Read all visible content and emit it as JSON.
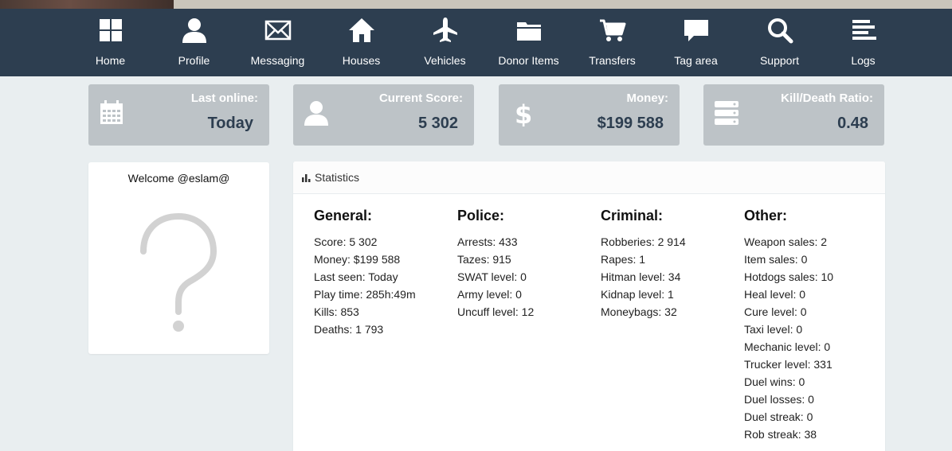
{
  "nav": [
    {
      "label": "Home",
      "icon": "grid-icon"
    },
    {
      "label": "Profile",
      "icon": "user-icon"
    },
    {
      "label": "Messaging",
      "icon": "envelope-icon"
    },
    {
      "label": "Houses",
      "icon": "house-icon"
    },
    {
      "label": "Vehicles",
      "icon": "plane-icon"
    },
    {
      "label": "Donor Items",
      "icon": "folder-icon"
    },
    {
      "label": "Transfers",
      "icon": "cart-icon"
    },
    {
      "label": "Tag area",
      "icon": "chat-bubble-icon"
    },
    {
      "label": "Support",
      "icon": "search-icon"
    },
    {
      "label": "Logs",
      "icon": "list-icon"
    }
  ],
  "stats": [
    {
      "label": "Last online:",
      "value": "Today",
      "icon": "calendar-icon"
    },
    {
      "label": "Current Score:",
      "value": "5 302",
      "icon": "user-icon"
    },
    {
      "label": "Money:",
      "value": "$199 588",
      "icon": "dollar-icon"
    },
    {
      "label": "Kill/Death Ratio:",
      "value": "0.48",
      "icon": "server-icon"
    }
  ],
  "welcome": {
    "text": "Welcome @eslam@",
    "avatar_icon": "question-mark-icon"
  },
  "panel": {
    "title": "Statistics",
    "icon": "bar-chart-icon",
    "columns": [
      {
        "heading": "General:",
        "rows": [
          "Score: 5 302",
          "Money: $199 588",
          "Last seen: Today",
          "Play time: 285h:49m",
          "Kills: 853",
          "Deaths: 1 793"
        ]
      },
      {
        "heading": "Police:",
        "rows": [
          "Arrests: 433",
          "Tazes: 915",
          "SWAT level: 0",
          "Army level: 0",
          "Uncuff level: 12"
        ]
      },
      {
        "heading": "Criminal:",
        "rows": [
          "Robberies: 2 914",
          "Rapes: 1",
          "Hitman level: 34",
          "Kidnap level: 1",
          "Moneybags: 32"
        ]
      },
      {
        "heading": "Other:",
        "rows": [
          "Weapon sales: 2",
          "Item sales: 0",
          "Hotdogs sales: 10",
          "Heal level: 0",
          "Cure level: 0",
          "Taxi level: 0",
          "Mechanic level: 0",
          "Trucker level: 331",
          "Duel wins: 0",
          "Duel losses: 0",
          "Duel streak: 0",
          "Rob streak: 38"
        ]
      }
    ]
  },
  "colors": {
    "navbar": "#2d3e50",
    "card": "#bdc3c7",
    "background": "#e9eef0",
    "value_text": "#2d3e50"
  }
}
